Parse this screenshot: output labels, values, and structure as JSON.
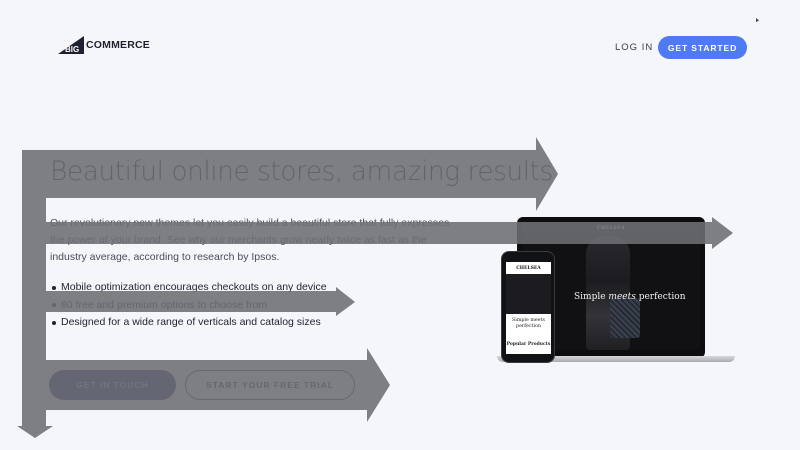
{
  "header": {
    "logo_text": "COMMERCE",
    "logo_prefix": "BIG",
    "login_label": "LOG IN",
    "get_started_label": "GET STARTED"
  },
  "hero": {
    "headline": "Beautiful online stores, amazing results",
    "paragraph": "Our revolutionary new themes let you easily build a beautiful store that fully expresses the power of your brand. See why our merchants grow nearly twice as fast as the industry average, according to research by Ipsos.",
    "bullets": [
      "Mobile optimization encourages checkouts on any device",
      "80 free and premium options to choose from",
      "Designed for a wide range of verticals and catalog sizes"
    ],
    "contact_button_label": "GET IN TOUCH",
    "trial_button_label": "START YOUR FREE TRIAL"
  },
  "mockup": {
    "laptop_brand": "CHELSEA",
    "laptop_tagline_pre": "Simple ",
    "laptop_tagline_em": "meets",
    "laptop_tagline_post": " perfection",
    "phone_brand": "CHELSEA",
    "phone_tagline": "Simple meets perfection",
    "phone_section": "Popular Products"
  },
  "colors": {
    "background": "#f5f6f9",
    "accent_blue": "#4e7bf2",
    "dark_navy_button": "#23357a",
    "overlay_arrow_gray": "#6d6e72"
  }
}
